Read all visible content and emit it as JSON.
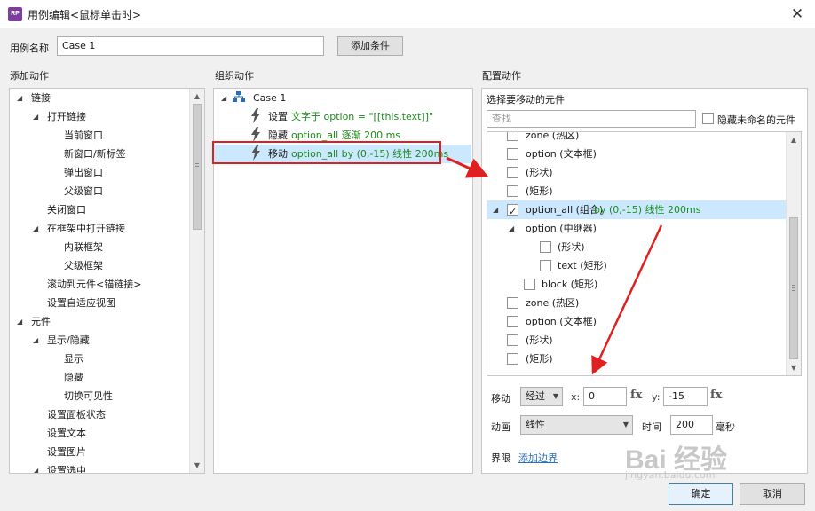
{
  "window": {
    "title": "用例编辑<鼠标单击时>",
    "app_icon": "RP",
    "close_glyph": "✕"
  },
  "case_name": {
    "label": "用例名称",
    "value": "Case 1",
    "add_condition_button": "添加条件"
  },
  "add_actions": {
    "header": "添加动作",
    "items": [
      {
        "label": "链接",
        "level": 0,
        "expanded": true
      },
      {
        "label": "打开链接",
        "level": 1,
        "expanded": true
      },
      {
        "label": "当前窗口",
        "level": 2
      },
      {
        "label": "新窗口/新标签",
        "level": 2
      },
      {
        "label": "弹出窗口",
        "level": 2
      },
      {
        "label": "父级窗口",
        "level": 2
      },
      {
        "label": "关闭窗口",
        "level": 1
      },
      {
        "label": "在框架中打开链接",
        "level": 1,
        "expanded": true
      },
      {
        "label": "内联框架",
        "level": 2
      },
      {
        "label": "父级框架",
        "level": 2
      },
      {
        "label": "滚动到元件<锚链接>",
        "level": 1
      },
      {
        "label": "设置自适应视图",
        "level": 1
      },
      {
        "label": "元件",
        "level": 0,
        "expanded": true
      },
      {
        "label": "显示/隐藏",
        "level": 1,
        "expanded": true
      },
      {
        "label": "显示",
        "level": 2
      },
      {
        "label": "隐藏",
        "level": 2
      },
      {
        "label": "切换可见性",
        "level": 2
      },
      {
        "label": "设置面板状态",
        "level": 1
      },
      {
        "label": "设置文本",
        "level": 1
      },
      {
        "label": "设置图片",
        "level": 1
      },
      {
        "label": "设置选中",
        "level": 1,
        "expanded": true
      }
    ]
  },
  "organize_actions": {
    "header": "组织动作",
    "case_label": "Case 1",
    "actions": [
      {
        "verb": "设置",
        "detail": "文字于 option = \"[[this.text]]\"",
        "selected": false
      },
      {
        "verb": "隐藏",
        "detail": "option_all 逐渐 200 ms",
        "selected": false
      },
      {
        "verb": "移动",
        "detail": "option_all by (0,-15) 线性 200ms",
        "selected": true
      }
    ]
  },
  "configure_actions": {
    "header": "配置动作",
    "select_label": "选择要移动的元件",
    "search_placeholder": "查找",
    "hide_unnamed_label": "隐藏未命名的元件",
    "hide_unnamed_checked": false,
    "widgets": [
      {
        "label": "zone (热区)",
        "detail": "",
        "indent": 0,
        "checked": false,
        "expander": false
      },
      {
        "label": "option (文本框)",
        "detail": "",
        "indent": 0,
        "checked": false,
        "expander": false
      },
      {
        "label": "(形状)",
        "detail": "",
        "indent": 0,
        "checked": false,
        "expander": false
      },
      {
        "label": "(矩形)",
        "detail": "",
        "indent": 0,
        "checked": false,
        "expander": false
      },
      {
        "label": "option_all (组合)",
        "detail": " by (0,-15) 线性 200ms",
        "indent": 0,
        "checked": true,
        "expander": true,
        "highlighted": true
      },
      {
        "label": "option (中继器)",
        "detail": "",
        "indent": 1,
        "checked": null,
        "expander": true
      },
      {
        "label": "(形状)",
        "detail": "",
        "indent": 3,
        "checked": false,
        "expander": false
      },
      {
        "label": "text (矩形)",
        "detail": "",
        "indent": 3,
        "checked": false,
        "expander": false
      },
      {
        "label": "block (矩形)",
        "detail": "",
        "indent": 2,
        "checked": false,
        "expander": false
      },
      {
        "label": "zone (热区)",
        "detail": "",
        "indent": 0,
        "checked": false,
        "expander": false
      },
      {
        "label": "option (文本框)",
        "detail": "",
        "indent": 0,
        "checked": false,
        "expander": false
      },
      {
        "label": "(形状)",
        "detail": "",
        "indent": 0,
        "checked": false,
        "expander": false
      },
      {
        "label": "(矩形)",
        "detail": "",
        "indent": 0,
        "checked": false,
        "expander": false
      }
    ],
    "move": {
      "label": "移动",
      "mode": "经过",
      "x_label": "x:",
      "x_value": "0",
      "y_label": "y:",
      "y_value": "-15",
      "fx": "fx"
    },
    "animate": {
      "label": "动画",
      "easing": "线性",
      "time_label": "时间",
      "time_value": "200",
      "unit": "毫秒"
    },
    "bounds": {
      "label": "界限",
      "link": "添加边界"
    }
  },
  "footer": {
    "ok_button": "确定",
    "cancel_button": "取消"
  },
  "watermark": {
    "text": "Bai 经验",
    "sub": "jingyan.baidu.com"
  },
  "colors": {
    "highlight_red": "#e02020",
    "selected_row": "#cce8ff",
    "action_green": "#198c19",
    "bolt": "#555555",
    "link_blue": "#2a6fb5"
  }
}
